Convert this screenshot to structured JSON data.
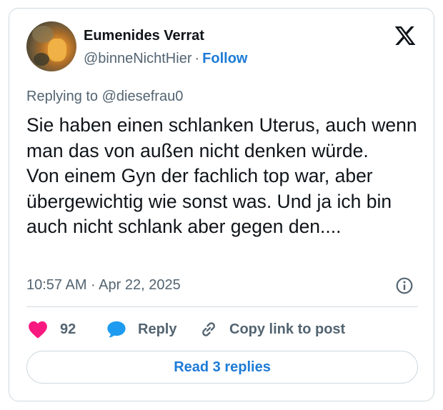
{
  "author": {
    "display_name": "Eumenides Verrat",
    "handle": "@binneNichtHier",
    "separator": "·",
    "follow_label": "Follow"
  },
  "reply_context": "Replying to @diesefrau0",
  "tweet": {
    "text": "Sie haben einen schlanken Uterus, auch wenn man das von außen nicht denken würde.\nVon einem Gyn der fachlich top war, aber übergewichtig wie sonst was. Und ja ich bin auch nicht schlank aber gegen den....",
    "timestamp": "10:57 AM · Apr 22, 2025"
  },
  "actions": {
    "like_count": "92",
    "reply_label": "Reply",
    "copy_link_label": "Copy link to post"
  },
  "read_replies_label": "Read 3 replies",
  "icons": {
    "brand": "x-logo-icon",
    "info": "info-icon",
    "like": "heart-icon",
    "reply": "speech-bubble-icon",
    "copy": "link-icon"
  },
  "colors": {
    "link_blue": "#1d7bd6",
    "heart": "#f91880",
    "reply_bubble": "#1d9bf0",
    "muted_text": "#536471",
    "border": "#cfd9de"
  }
}
